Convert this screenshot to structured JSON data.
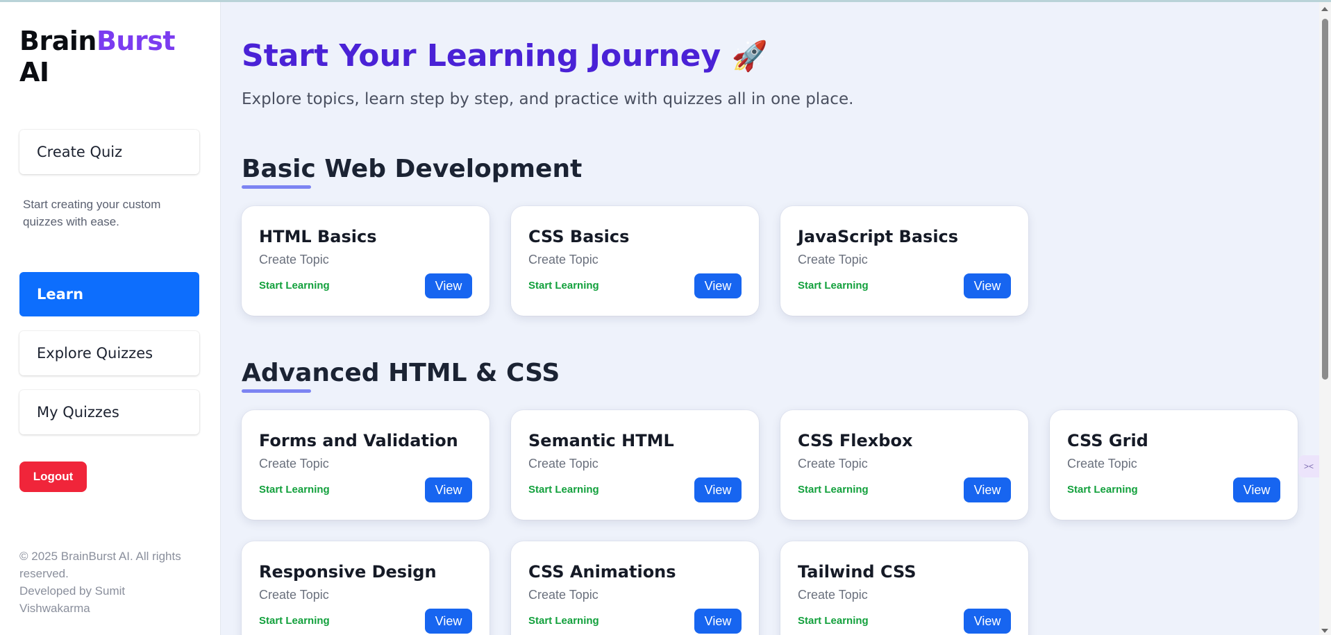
{
  "sidebar": {
    "brand_part1": "Brain",
    "brand_part2": "Burst",
    "brand_part3": "AI",
    "create_quiz": "Create Quiz",
    "create_quiz_desc": "Start creating your custom quizzes with ease.",
    "learn": "Learn",
    "explore_quizzes": "Explore Quizzes",
    "my_quizzes": "My Quizzes",
    "logout": "Logout",
    "footer_copyright": "© 2025 BrainBurst AI. All rights reserved.",
    "footer_developer": "Developed by Sumit Vishwakarma"
  },
  "main": {
    "title": "Start Your Learning Journey",
    "title_emoji": "🚀",
    "subtitle": "Explore topics, learn step by step, and practice with quizzes all in one place.",
    "sections": [
      {
        "title": "Basic Web Development",
        "cards": [
          {
            "title": "HTML Basics",
            "sub": "Create Topic",
            "start": "Start Learning",
            "view": "View"
          },
          {
            "title": "CSS Basics",
            "sub": "Create Topic",
            "start": "Start Learning",
            "view": "View"
          },
          {
            "title": "JavaScript Basics",
            "sub": "Create Topic",
            "start": "Start Learning",
            "view": "View"
          }
        ]
      },
      {
        "title": "Advanced HTML & CSS",
        "cards": [
          {
            "title": "Forms and Validation",
            "sub": "Create Topic",
            "start": "Start Learning",
            "view": "View"
          },
          {
            "title": "Semantic HTML",
            "sub": "Create Topic",
            "start": "Start Learning",
            "view": "View"
          },
          {
            "title": "CSS Flexbox",
            "sub": "Create Topic",
            "start": "Start Learning",
            "view": "View"
          },
          {
            "title": "CSS Grid",
            "sub": "Create Topic",
            "start": "Start Learning",
            "view": "View"
          },
          {
            "title": "Responsive Design",
            "sub": "Create Topic",
            "start": "Start Learning",
            "view": "View"
          },
          {
            "title": "CSS Animations",
            "sub": "Create Topic",
            "start": "Start Learning",
            "view": "View"
          },
          {
            "title": "Tailwind CSS",
            "sub": "Create Topic",
            "start": "Start Learning",
            "view": "View"
          }
        ]
      }
    ]
  },
  "colors": {
    "brand_accent": "#7b3cf0",
    "title": "#4a22d6",
    "primary_button": "#1765f0",
    "active_nav": "#0d6efd",
    "logout": "#f0253a",
    "start_learning": "#12a03c"
  }
}
